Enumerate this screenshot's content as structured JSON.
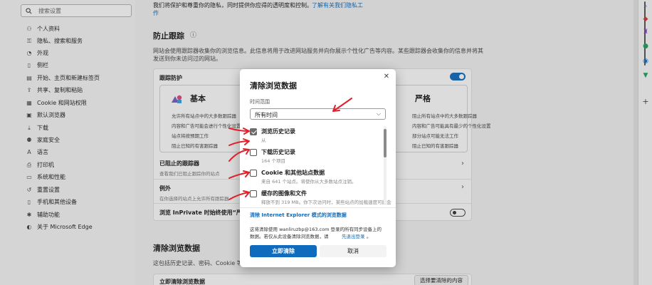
{
  "sidebar": {
    "search_placeholder": "搜索设置",
    "items": [
      {
        "label": "个人资料",
        "icon": "person-icon"
      },
      {
        "label": "隐私、搜索和服务",
        "icon": "lock-icon"
      },
      {
        "label": "外观",
        "icon": "appearance-icon"
      },
      {
        "label": "侧栏",
        "icon": "sidebar-icon"
      },
      {
        "label": "开始、主页和新建标签页",
        "icon": "home-tab-icon"
      },
      {
        "label": "共享、复制和粘贴",
        "icon": "share-icon"
      },
      {
        "label": "Cookie 和网站权限",
        "icon": "cookie-icon"
      },
      {
        "label": "默认浏览器",
        "icon": "browser-icon"
      },
      {
        "label": "下载",
        "icon": "download-icon"
      },
      {
        "label": "家庭安全",
        "icon": "family-icon"
      },
      {
        "label": "语言",
        "icon": "language-icon"
      },
      {
        "label": "打印机",
        "icon": "printer-icon"
      },
      {
        "label": "系统和性能",
        "icon": "system-icon"
      },
      {
        "label": "重置设置",
        "icon": "reset-icon"
      },
      {
        "label": "手机和其他设备",
        "icon": "phone-icon"
      },
      {
        "label": "辅助功能",
        "icon": "accessibility-icon"
      },
      {
        "label": "关于 Microsoft Edge",
        "icon": "edge-icon"
      }
    ]
  },
  "main": {
    "top_text_1": "我们将保护和尊重你的隐私，同时提供你应得的透明度和控制。",
    "top_link": "了解有关我们隐私工",
    "top_text_2": "作",
    "tracking_title": "防止跟踪",
    "tracking_desc_1": "网站会使用跟踪器收集你的浏览信息。此信息将用于改进网站服务并向你展示个性化广告等内容。某些跟踪器会收集你的信息并将其",
    "tracking_desc_2": "发送到你未访问过的网站。",
    "tracking_prevention_label": "跟踪防护",
    "basic": {
      "title": "基本",
      "bullets": [
        "允许所有站点中的大多数跟踪器",
        "内容和广告可能会进行个性化设置",
        "站点将按预期工作",
        "阻止已知的有害跟踪器"
      ]
    },
    "strict": {
      "title": "严格",
      "bullets": [
        "阻止所有站点中的大多数跟踪器",
        "内容和广告可能具有最少的个性化设置",
        "部分站点可能无法工作",
        "阻止已知的有害跟踪器"
      ]
    },
    "blocked_title": "已阻止的跟踪器",
    "blocked_desc": "查看我们已阻止跟踪你的站点",
    "exceptions_title": "例外",
    "exceptions_desc": "在你选择的站点上允许所有跟踪器",
    "inprivate_label": "浏览 InPrivate 时始终使用“严格”",
    "clear_title": "清除浏览数据",
    "clear_desc": "这包括历史记录、密码、Cookie 等。",
    "clear_now_label": "立即清除浏览数据",
    "choose_button": "选择要清除的内容"
  },
  "dialog": {
    "title": "清除浏览数据",
    "range_label": "时间范围",
    "range_value": "所有时间",
    "options": [
      {
        "label": "浏览历史记录",
        "sub": "从",
        "checked": true
      },
      {
        "label": "下载历史记录",
        "sub": "164 个项目",
        "checked": false
      },
      {
        "label": "Cookie 和其他站点数据",
        "sub": "来自 641 个站点。将使你从大多数站点注销。",
        "checked": false
      },
      {
        "label": "缓存的图像和文件",
        "sub": "释放不到 319 MB。你下次访问时，某些站点的加载速度可能会",
        "checked": false
      }
    ],
    "ie_link": "清除 Internet Explorer 模式的浏览数据",
    "sync_text_1": "这将清除使用 wanliruzbp@163.com 登录的所有同步设备上的",
    "sync_text_2": "数据。若仅从此设备清除浏览数据，请",
    "sync_link": "先退出登录",
    "sync_end": "。",
    "clear_button": "立即清除",
    "cancel_button": "取消"
  },
  "colors": {
    "accent": "#0f6cbd",
    "annotation": "#e0202a"
  }
}
